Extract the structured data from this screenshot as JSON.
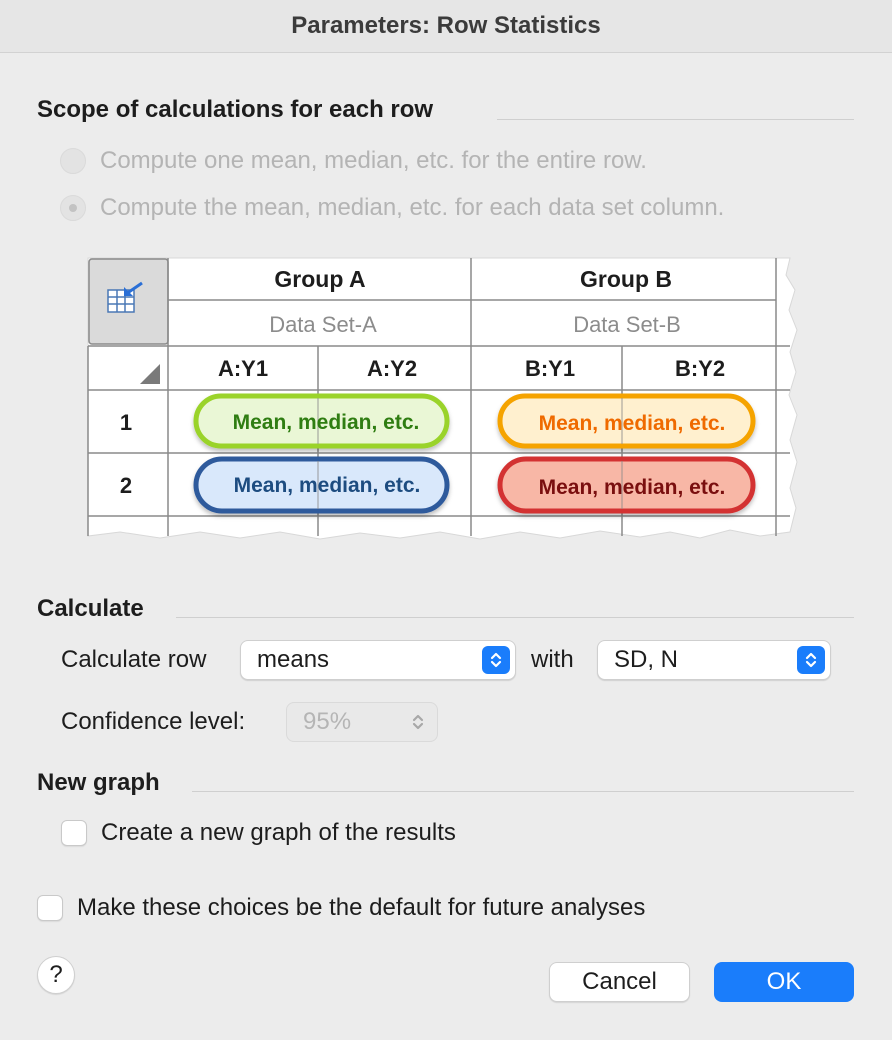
{
  "window": {
    "title": "Parameters: Row Statistics"
  },
  "scope": {
    "heading": "Scope of calculations for each row",
    "option_entire_row": "Compute one mean, median, etc. for the entire row.",
    "option_each_column": "Compute the mean, median, etc. for each data set column."
  },
  "diagram": {
    "group_a": "Group A",
    "group_b": "Group B",
    "dataset_a": "Data Set-A",
    "dataset_b": "Data Set-B",
    "columns": [
      "A:Y1",
      "A:Y2",
      "B:Y1",
      "B:Y2"
    ],
    "rows": [
      "1",
      "2"
    ],
    "pill_text": "Mean, median, etc.",
    "colors": {
      "green_border": "#9ad32a",
      "green_fill": "#eaf7d6",
      "green_text": "#2f7d12",
      "orange_border": "#f5a300",
      "orange_fill": "#fff0cf",
      "orange_text": "#ef6a00",
      "blue_border": "#2d5a9c",
      "blue_fill": "#d9e8fb",
      "blue_text": "#1d4c80",
      "red_border": "#d33232",
      "red_fill": "#f8b7a6",
      "red_text": "#7a0f0f"
    }
  },
  "calculate": {
    "heading": "Calculate",
    "row_label": "Calculate row",
    "row_value": "means",
    "with_label": "with",
    "with_value": "SD, N",
    "confidence_label": "Confidence level:",
    "confidence_value": "95%"
  },
  "new_graph": {
    "heading": "New graph",
    "checkbox_label": "Create a new graph of the results"
  },
  "default_checkbox_label": "Make these choices be the default for future analyses",
  "buttons": {
    "help": "?",
    "cancel": "Cancel",
    "ok": "OK"
  },
  "accent_color": "#1a7dfb"
}
